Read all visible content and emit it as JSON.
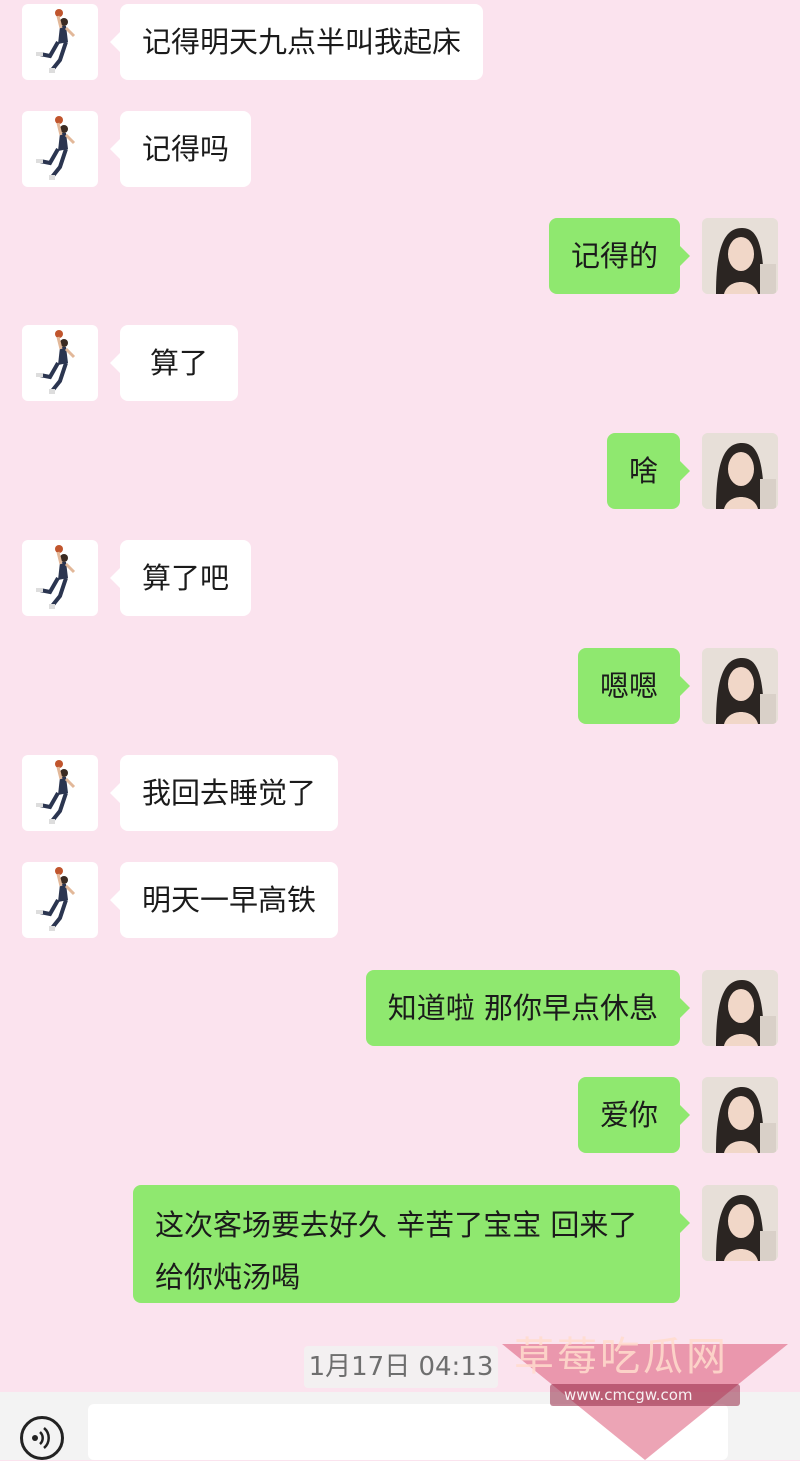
{
  "messages": [
    {
      "side": "in",
      "text": "记得明天九点半叫我起床"
    },
    {
      "side": "in",
      "text": "记得吗"
    },
    {
      "side": "out",
      "text": "记得的"
    },
    {
      "side": "in",
      "text": "算了"
    },
    {
      "side": "out",
      "text": "啥"
    },
    {
      "side": "in",
      "text": "算了吧"
    },
    {
      "side": "out",
      "text": "嗯嗯"
    },
    {
      "side": "in",
      "text": "我回去睡觉了"
    },
    {
      "side": "in",
      "text": "明天一早高铁"
    },
    {
      "side": "out",
      "text": "知道啦 那你早点休息"
    },
    {
      "side": "out",
      "text": "爱你"
    },
    {
      "side": "out",
      "text": "这次客场要去好久 辛苦了宝宝 回来了给你炖汤喝"
    }
  ],
  "timestamp": "1月17日 04:13",
  "watermark": {
    "title": "草莓吃瓜网",
    "url": "www.cmcgw.com"
  },
  "icons": {
    "voice": "voice-input-icon",
    "avatar_left": "basketball-player-avatar",
    "avatar_right": "girl-photo-avatar"
  },
  "colors": {
    "background": "#fbe3ee",
    "incoming_bubble": "#ffffff",
    "outgoing_bubble": "#8fe86f"
  }
}
